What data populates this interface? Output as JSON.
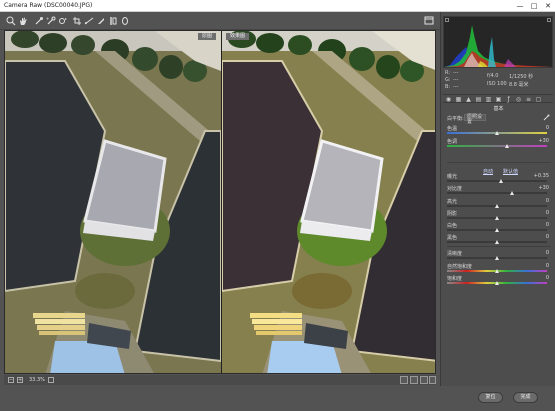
{
  "window": {
    "title": "Camera Raw (DSC00040.JPG)",
    "minimize": "—",
    "maximize": "□",
    "close": "✕"
  },
  "toolbar": {
    "tools": [
      "zoom-icon",
      "hand-icon",
      "white-balance-icon",
      "color-sampler-icon",
      "targeted-adjust-icon",
      "crop-icon",
      "straighten-icon",
      "spot-removal-icon",
      "red-eye-icon",
      "adjustment-brush-icon",
      "graduated-filter-icon",
      "radial-filter-icon"
    ]
  },
  "preview": {
    "before_label": "原图",
    "after_label": "效果图"
  },
  "status": {
    "zoom": "33.3%"
  },
  "histogram": {
    "readout": {
      "r_label": "R:",
      "r_value": "---",
      "g_label": "G:",
      "g_value": "---",
      "b_label": "B:",
      "b_value": "---",
      "aperture": "f/4.0",
      "shutter": "1/1250 秒",
      "iso": "ISO 100",
      "focal": "8.8 毫米"
    }
  },
  "panel": {
    "tabs": [
      "basic",
      "tone-curve",
      "detail",
      "hsl",
      "split-toning",
      "lens",
      "fx",
      "calibration",
      "presets",
      "snapshots"
    ],
    "section_title": "基本",
    "white_balance": {
      "label": "白平衡:",
      "value": "原照设置"
    },
    "auto_label": "自动",
    "default_label": "默认值",
    "sliders": [
      {
        "label": "色温",
        "value": "0",
        "pos": 0.5,
        "gradient": "temp"
      },
      {
        "label": "色调",
        "value": "+30",
        "pos": 0.6,
        "gradient": "tint"
      },
      {
        "label": "曝光",
        "value": "+0.35",
        "pos": 0.54,
        "gradient": "gray"
      },
      {
        "label": "对比度",
        "value": "+30",
        "pos": 0.65,
        "gradient": "gray"
      },
      {
        "label": "高光",
        "value": "0",
        "pos": 0.5,
        "gradient": "gray"
      },
      {
        "label": "阴影",
        "value": "0",
        "pos": 0.5,
        "gradient": "gray"
      },
      {
        "label": "白色",
        "value": "0",
        "pos": 0.5,
        "gradient": "gray"
      },
      {
        "label": "黑色",
        "value": "0",
        "pos": 0.5,
        "gradient": "gray"
      },
      {
        "label": "清晰度",
        "value": "0",
        "pos": 0.5,
        "gradient": "gray"
      },
      {
        "label": "自然饱和度",
        "value": "0",
        "pos": 0.5,
        "gradient": "sat"
      },
      {
        "label": "饱和度",
        "value": "0",
        "pos": 0.5,
        "gradient": "sat"
      }
    ]
  },
  "buttons": {
    "reset": "复位",
    "done": "完成"
  }
}
